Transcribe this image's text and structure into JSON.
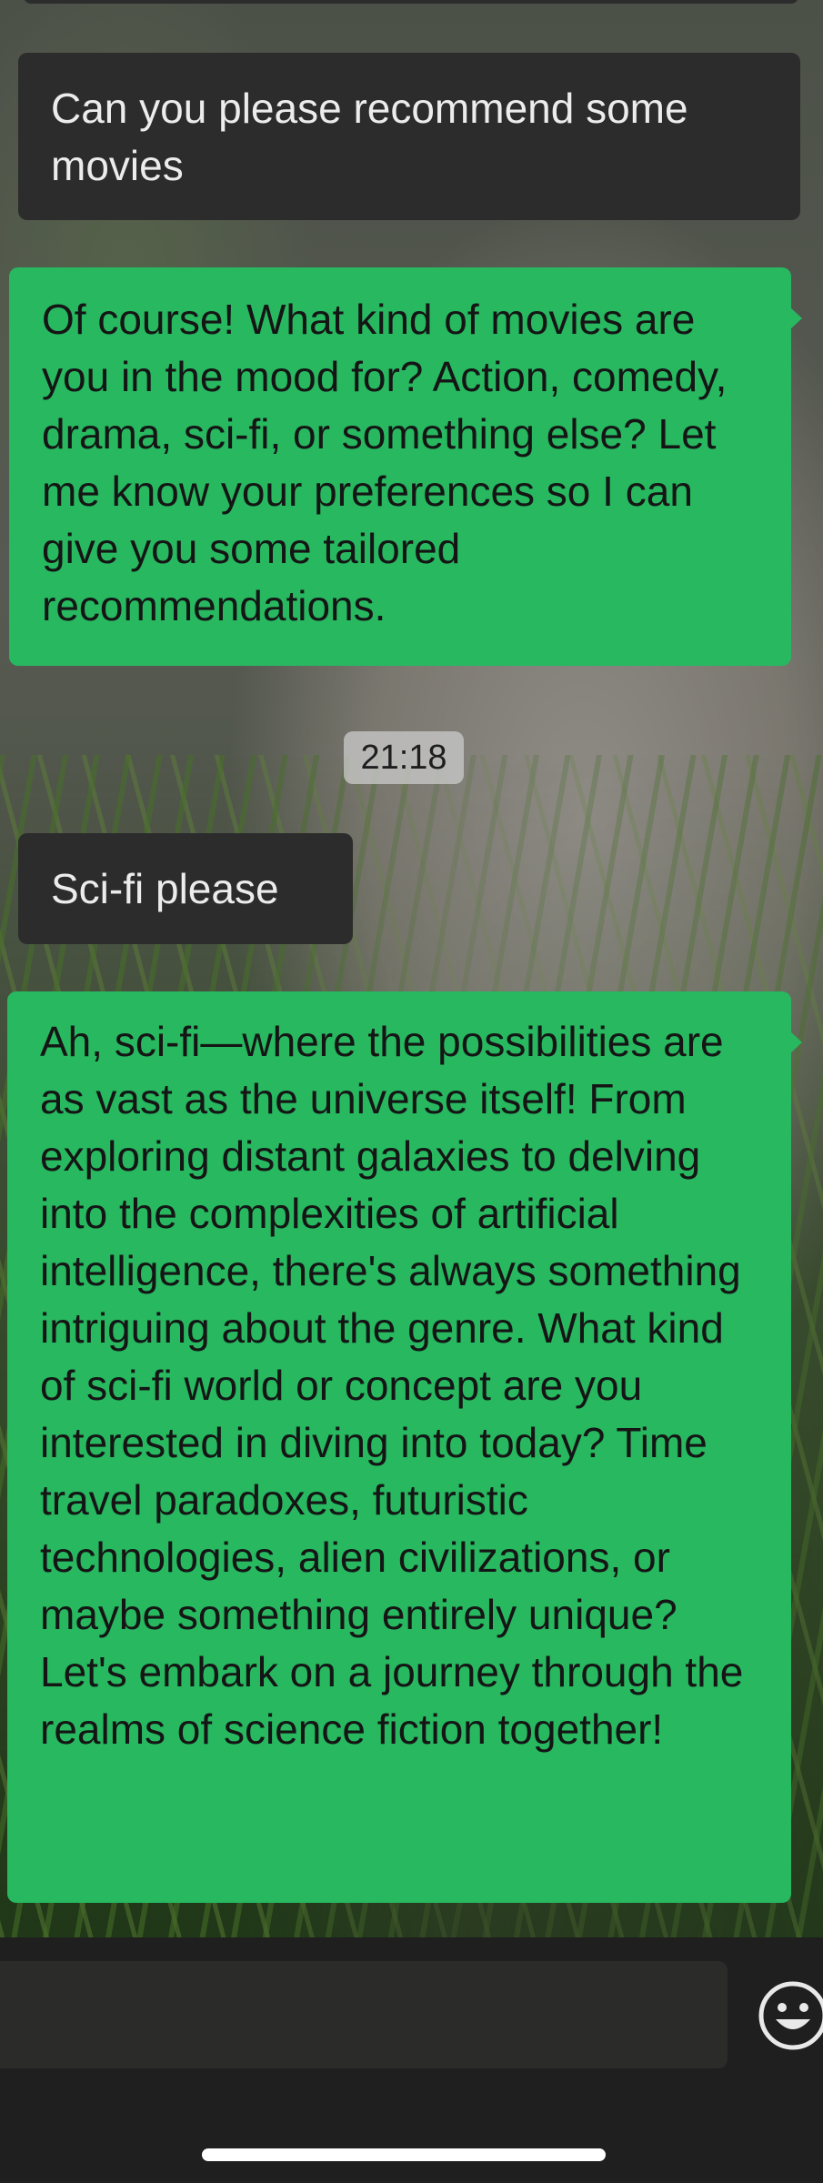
{
  "conversation": {
    "messages": [
      {
        "side": "sent",
        "text": "Can you please recommend some movies"
      },
      {
        "side": "received",
        "text": "Of course! What kind of movies are you in the mood for? Action, comedy, drama, sci-fi, or something else? Let me know your preferences so I can give you some tailored recommendations."
      },
      {
        "side": "sent",
        "text": "Sci-fi please"
      },
      {
        "side": "received",
        "text": "Ah, sci-fi—where the possibilities are as vast as the universe itself! From exploring distant galaxies to delving into the complexities of artificial intelligence, there's always something intriguing about the genre. What kind of sci-fi world or concept are you interested in diving into today? Time travel paradoxes, futuristic technologies, alien civilizations, or maybe something entirely unique? Let's embark on a journey through the realms of science fiction together!"
      }
    ],
    "timestamp": "21:18"
  },
  "composer": {
    "input_value": "",
    "emoji_icon": "smiley-face-icon"
  },
  "colors": {
    "received_bubble": "#27b860",
    "sent_bubble": "#2c2c2c"
  }
}
